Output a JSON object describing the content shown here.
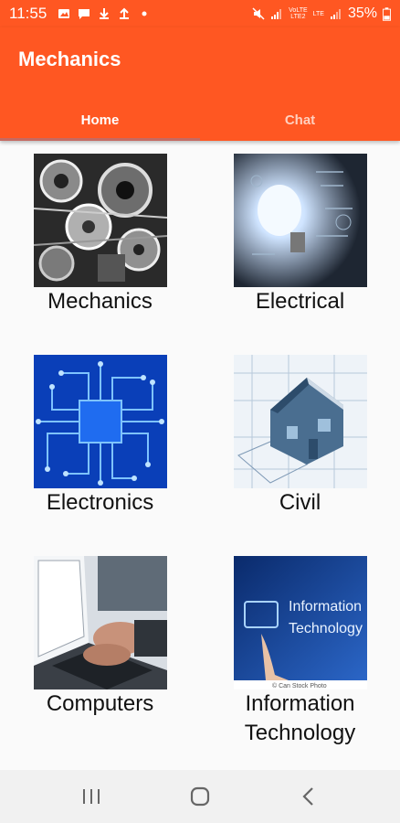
{
  "status_bar": {
    "time": "11:55",
    "network_label_top": "VoLTE",
    "network_label_bottom": "LTE2",
    "lte_label": "LTE",
    "battery": "35%"
  },
  "app_bar": {
    "title": "Mechanics",
    "color": "#ff5722"
  },
  "tabs": [
    {
      "label": "Home",
      "active": true
    },
    {
      "label": "Chat",
      "active": false
    }
  ],
  "categories": [
    {
      "label": "Mechanics",
      "image": "engine-image"
    },
    {
      "label": "Electrical",
      "image": "light-bulb-image"
    },
    {
      "label": "Electronics",
      "image": "circuit-board-image"
    },
    {
      "label": "Civil",
      "image": "house-blueprint-image"
    },
    {
      "label": "Computers",
      "image": "laptop-typing-image"
    },
    {
      "label": "Information Technology",
      "label_line1": "Information",
      "label_line2": "Technology",
      "image": "information-technology-image",
      "image_caption": "Information Technology",
      "image_caption_line1": "Information",
      "image_caption_line2": "Technology",
      "watermark": "© Can Stock Photo"
    }
  ],
  "nav_bar": {
    "buttons": [
      "recent-apps",
      "home",
      "back"
    ]
  }
}
